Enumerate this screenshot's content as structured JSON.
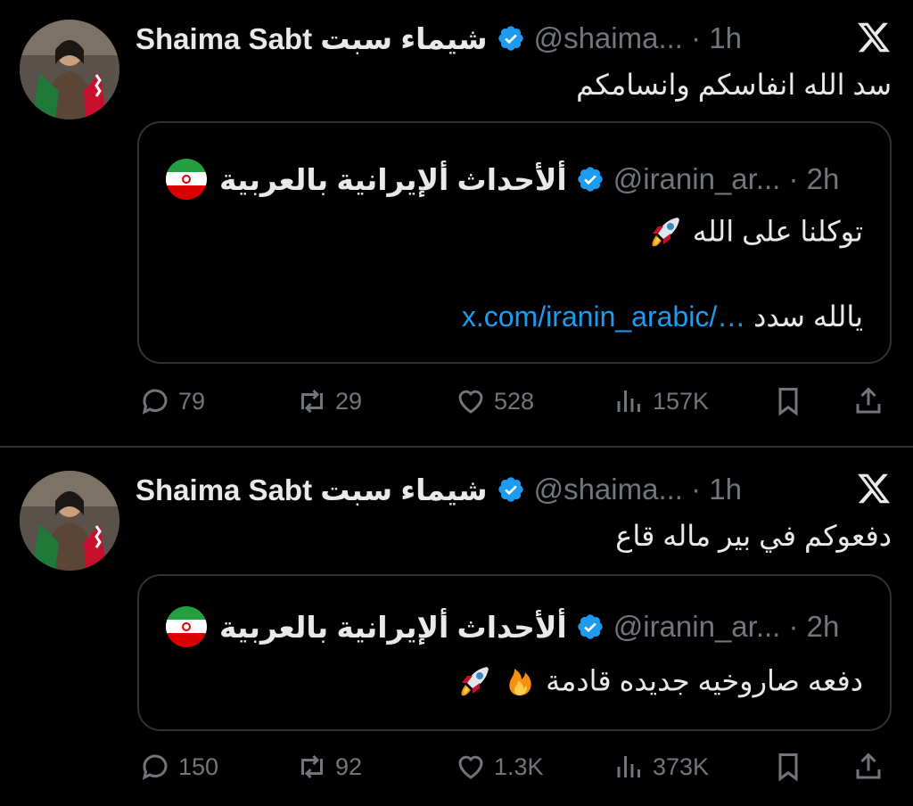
{
  "tweets": [
    {
      "author": {
        "display_name": "Shaima Sabt شيماء سبت",
        "handle_time": "@shaima... · 1h"
      },
      "text": "سد الله انفاسكم وانسامكم",
      "quote": {
        "author": {
          "display_name": "ألأحداث ألإيرانية بالعربية",
          "handle_time": "@iranin_ar... · 2h"
        },
        "line1": "توكلنا على الله",
        "line2_text": "يالله سدد",
        "line2_link": "x.com/iranin_arabic/…"
      },
      "actions": {
        "replies": "79",
        "reposts": "29",
        "likes": "528",
        "views": "157K"
      }
    },
    {
      "author": {
        "display_name": "Shaima Sabt شيماء سبت",
        "handle_time": "@shaima... · 1h"
      },
      "text": "دفعوكم في بير ماله قاع",
      "quote": {
        "author": {
          "display_name": "ألأحداث ألإيرانية بالعربية",
          "handle_time": "@iranin_ar... · 2h"
        },
        "line1": "دفعه صاروخيه جديده قادمة"
      },
      "actions": {
        "replies": "150",
        "reposts": "92",
        "likes": "1.3K",
        "views": "373K"
      }
    }
  ],
  "icons": {
    "reply": "reply-icon",
    "repost": "repost-icon",
    "like": "heart-icon",
    "views": "views-icon",
    "bookmark": "bookmark-icon",
    "share": "share-icon",
    "verified": "verified-icon",
    "brand": "x-logo-icon",
    "rocket": "rocket-emoji",
    "fire": "fire-emoji"
  },
  "colors": {
    "background": "#000000",
    "text": "#e7e9ea",
    "muted": "#71767b",
    "link": "#1d9bf0",
    "border": "#2f3336",
    "verified": "#1d9bf0"
  }
}
